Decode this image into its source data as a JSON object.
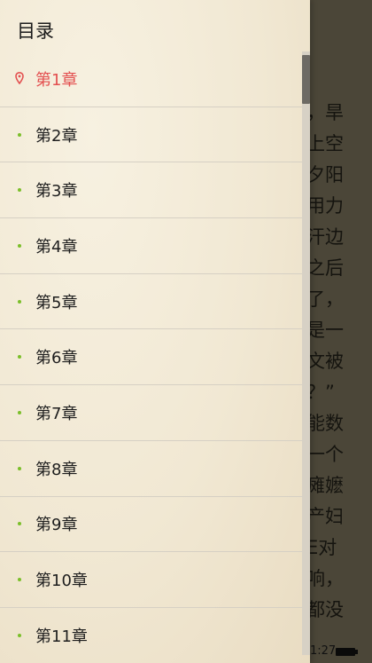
{
  "drawer": {
    "title": "目录",
    "chapters": [
      {
        "label": "第1章",
        "current": true
      },
      {
        "label": "第2章",
        "current": false
      },
      {
        "label": "第3章",
        "current": false
      },
      {
        "label": "第4章",
        "current": false
      },
      {
        "label": "第5章",
        "current": false
      },
      {
        "label": "第6章",
        "current": false
      },
      {
        "label": "第7章",
        "current": false
      },
      {
        "label": "第8章",
        "current": false
      },
      {
        "label": "第9章",
        "current": false
      },
      {
        "label": "第10章",
        "current": false
      },
      {
        "label": "第11章",
        "current": false
      }
    ]
  },
  "reader": {
    "visible_text_fragments": [
      "，旱",
      "上空",
      "夕阳",
      "用力",
      "汗边",
      "之后",
      "了，",
      "是一",
      "文被",
      "？”",
      "能数",
      "一个",
      "瘫嬷",
      "产妇",
      "E对",
      "响，",
      "都没"
    ]
  },
  "status_bar": {
    "time": "1:27"
  },
  "colors": {
    "accent_current": "#e35050",
    "bullet": "#7bbf2a",
    "drawer_bg": "#f3ebd7",
    "overlay_bg": "#4b4638"
  },
  "icons": {
    "current_marker": "location-pin-icon",
    "bullet": "dot-icon",
    "battery": "battery-icon"
  }
}
